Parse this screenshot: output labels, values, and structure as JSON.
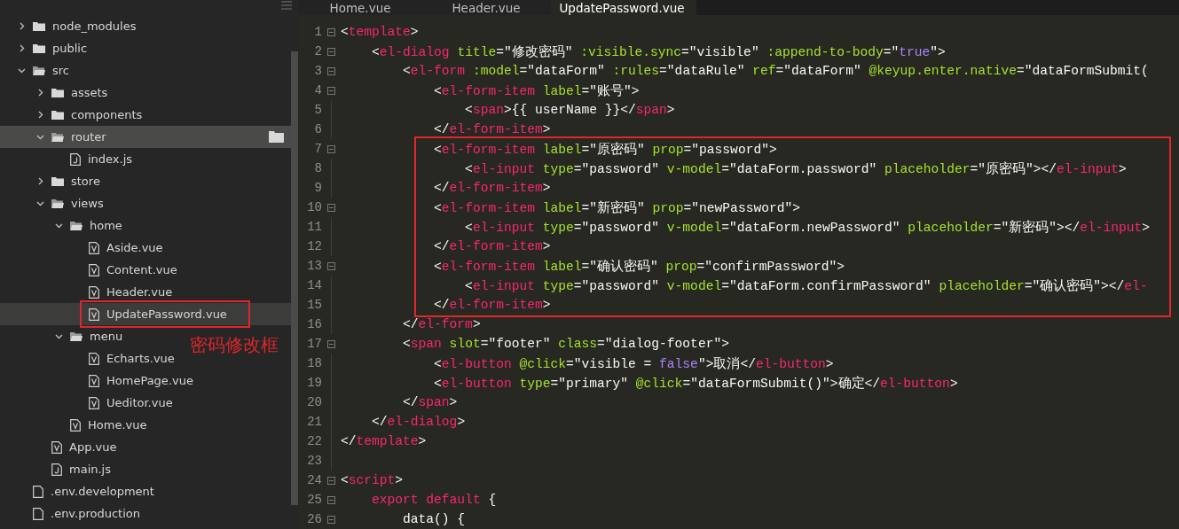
{
  "sidebar": {
    "annotation": {
      "text": "密码修改框"
    },
    "tree": [
      {
        "label": "node_modules",
        "kind": "folder",
        "expanded": false,
        "selected": false,
        "hovered": false,
        "annotated": false
      },
      {
        "label": "public",
        "kind": "folder",
        "expanded": false,
        "selected": false,
        "hovered": false,
        "annotated": false
      },
      {
        "label": "src",
        "kind": "folder",
        "expanded": true,
        "selected": false,
        "hovered": false,
        "annotated": false,
        "children": [
          {
            "label": "assets",
            "kind": "folder",
            "expanded": false,
            "selected": false,
            "hovered": false,
            "annotated": false
          },
          {
            "label": "components",
            "kind": "folder",
            "expanded": false,
            "selected": false,
            "hovered": false,
            "annotated": false
          },
          {
            "label": "router",
            "kind": "folder",
            "expanded": true,
            "selected": false,
            "hovered": true,
            "annotated": false,
            "children": [
              {
                "label": "index.js",
                "kind": "js-file",
                "selected": false,
                "hovered": false,
                "annotated": false
              }
            ]
          },
          {
            "label": "store",
            "kind": "folder",
            "expanded": false,
            "selected": false,
            "hovered": false,
            "annotated": false
          },
          {
            "label": "views",
            "kind": "folder",
            "expanded": true,
            "selected": false,
            "hovered": false,
            "annotated": false,
            "children": [
              {
                "label": "home",
                "kind": "folder",
                "expanded": true,
                "selected": false,
                "hovered": false,
                "annotated": false,
                "children": [
                  {
                    "label": "Aside.vue",
                    "kind": "vue-file",
                    "selected": false,
                    "hovered": false,
                    "annotated": false
                  },
                  {
                    "label": "Content.vue",
                    "kind": "vue-file",
                    "selected": false,
                    "hovered": false,
                    "annotated": false
                  },
                  {
                    "label": "Header.vue",
                    "kind": "vue-file",
                    "selected": false,
                    "hovered": false,
                    "annotated": false
                  },
                  {
                    "label": "UpdatePassword.vue",
                    "kind": "vue-file",
                    "selected": true,
                    "hovered": false,
                    "annotated": true
                  }
                ]
              },
              {
                "label": "menu",
                "kind": "folder",
                "expanded": true,
                "selected": false,
                "hovered": false,
                "annotated": false,
                "children": [
                  {
                    "label": "Echarts.vue",
                    "kind": "vue-file",
                    "selected": false,
                    "hovered": false,
                    "annotated": false
                  },
                  {
                    "label": "HomePage.vue",
                    "kind": "vue-file",
                    "selected": false,
                    "hovered": false,
                    "annotated": false
                  },
                  {
                    "label": "Ueditor.vue",
                    "kind": "vue-file",
                    "selected": false,
                    "hovered": false,
                    "annotated": false
                  }
                ]
              },
              {
                "label": "Home.vue",
                "kind": "vue-file",
                "selected": false,
                "hovered": false,
                "annotated": false
              }
            ]
          },
          {
            "label": "App.vue",
            "kind": "vue-file",
            "selected": false,
            "hovered": false,
            "annotated": false
          },
          {
            "label": "main.js",
            "kind": "js-file",
            "selected": false,
            "hovered": false,
            "annotated": false
          }
        ]
      },
      {
        "label": ".env.development",
        "kind": "file",
        "selected": false,
        "hovered": false,
        "annotated": false
      },
      {
        "label": ".env.production",
        "kind": "file",
        "selected": false,
        "hovered": false,
        "annotated": false
      }
    ]
  },
  "tabs": [
    {
      "label": "Home.vue",
      "selected": false
    },
    {
      "label": "Header.vue",
      "selected": false
    },
    {
      "label": "UpdatePassword.vue",
      "selected": true
    }
  ],
  "code": [
    {
      "number": "1",
      "fold": true,
      "highlight": false,
      "tokens": [
        {
          "kind": "p",
          "text": "<"
        },
        {
          "kind": "t",
          "text": "template"
        },
        {
          "kind": "p",
          "text": ">"
        }
      ]
    },
    {
      "number": "2",
      "fold": true,
      "highlight": false,
      "tokens": [
        {
          "kind": "p",
          "text": "    <"
        },
        {
          "kind": "t",
          "text": "el-dialog"
        },
        {
          "kind": "a",
          "text": " title"
        },
        {
          "kind": "p",
          "text": "=\"修改密码\""
        },
        {
          "kind": "a",
          "text": " :visible.sync"
        },
        {
          "kind": "p",
          "text": "=\"visible\""
        },
        {
          "kind": "a",
          "text": " :append-to-body"
        },
        {
          "kind": "p",
          "text": "=\""
        },
        {
          "kind": "c",
          "text": "true"
        },
        {
          "kind": "p",
          "text": "\">"
        }
      ]
    },
    {
      "number": "3",
      "fold": true,
      "highlight": false,
      "tokens": [
        {
          "kind": "p",
          "text": "        <"
        },
        {
          "kind": "t",
          "text": "el-form"
        },
        {
          "kind": "a",
          "text": " :model"
        },
        {
          "kind": "p",
          "text": "=\"dataForm\""
        },
        {
          "kind": "a",
          "text": " :rules"
        },
        {
          "kind": "p",
          "text": "=\"dataRule\""
        },
        {
          "kind": "a",
          "text": " ref"
        },
        {
          "kind": "p",
          "text": "=\"dataForm\""
        },
        {
          "kind": "a",
          "text": " @keyup.enter.native"
        },
        {
          "kind": "p",
          "text": "=\"dataFormSubmit("
        }
      ]
    },
    {
      "number": "4",
      "fold": true,
      "highlight": false,
      "tokens": [
        {
          "kind": "p",
          "text": "            <"
        },
        {
          "kind": "t",
          "text": "el-form-item"
        },
        {
          "kind": "a",
          "text": " label"
        },
        {
          "kind": "p",
          "text": "=\"账号\">"
        }
      ]
    },
    {
      "number": "5",
      "fold": false,
      "highlight": false,
      "tokens": [
        {
          "kind": "p",
          "text": "                <"
        },
        {
          "kind": "t",
          "text": "span"
        },
        {
          "kind": "p",
          "text": ">{{ userName }}</"
        },
        {
          "kind": "t",
          "text": "span"
        },
        {
          "kind": "p",
          "text": ">"
        }
      ]
    },
    {
      "number": "6",
      "fold": false,
      "highlight": false,
      "tokens": [
        {
          "kind": "p",
          "text": "            </"
        },
        {
          "kind": "t",
          "text": "el-form-item"
        },
        {
          "kind": "p",
          "text": ">"
        }
      ]
    },
    {
      "number": "7",
      "fold": true,
      "highlight": true,
      "tokens": [
        {
          "kind": "p",
          "text": "            <"
        },
        {
          "kind": "t",
          "text": "el-form-item"
        },
        {
          "kind": "a",
          "text": " label"
        },
        {
          "kind": "p",
          "text": "=\"原密码\""
        },
        {
          "kind": "a",
          "text": " prop"
        },
        {
          "kind": "p",
          "text": "=\"password\">"
        }
      ]
    },
    {
      "number": "8",
      "fold": false,
      "highlight": true,
      "tokens": [
        {
          "kind": "p",
          "text": "                <"
        },
        {
          "kind": "t",
          "text": "el-input"
        },
        {
          "kind": "a",
          "text": " type"
        },
        {
          "kind": "p",
          "text": "=\"password\""
        },
        {
          "kind": "a",
          "text": " v-model"
        },
        {
          "kind": "p",
          "text": "=\"dataForm.password\""
        },
        {
          "kind": "a",
          "text": " placeholder"
        },
        {
          "kind": "p",
          "text": "=\"原密码\"></"
        },
        {
          "kind": "t",
          "text": "el-input"
        },
        {
          "kind": "p",
          "text": ">"
        }
      ]
    },
    {
      "number": "9",
      "fold": false,
      "highlight": true,
      "tokens": [
        {
          "kind": "p",
          "text": "            </"
        },
        {
          "kind": "t",
          "text": "el-form-item"
        },
        {
          "kind": "p",
          "text": ">"
        }
      ]
    },
    {
      "number": "10",
      "fold": true,
      "highlight": true,
      "tokens": [
        {
          "kind": "p",
          "text": "            <"
        },
        {
          "kind": "t",
          "text": "el-form-item"
        },
        {
          "kind": "a",
          "text": " label"
        },
        {
          "kind": "p",
          "text": "=\"新密码\""
        },
        {
          "kind": "a",
          "text": " prop"
        },
        {
          "kind": "p",
          "text": "=\"newPassword\">"
        }
      ]
    },
    {
      "number": "11",
      "fold": false,
      "highlight": true,
      "tokens": [
        {
          "kind": "p",
          "text": "                <"
        },
        {
          "kind": "t",
          "text": "el-input"
        },
        {
          "kind": "a",
          "text": " type"
        },
        {
          "kind": "p",
          "text": "=\"password\""
        },
        {
          "kind": "a",
          "text": " v-model"
        },
        {
          "kind": "p",
          "text": "=\"dataForm.newPassword\""
        },
        {
          "kind": "a",
          "text": " placeholder"
        },
        {
          "kind": "p",
          "text": "=\"新密码\"></"
        },
        {
          "kind": "t",
          "text": "el-input"
        },
        {
          "kind": "p",
          "text": ">"
        }
      ]
    },
    {
      "number": "12",
      "fold": false,
      "highlight": true,
      "tokens": [
        {
          "kind": "p",
          "text": "            </"
        },
        {
          "kind": "t",
          "text": "el-form-item"
        },
        {
          "kind": "p",
          "text": ">"
        }
      ]
    },
    {
      "number": "13",
      "fold": true,
      "highlight": true,
      "tokens": [
        {
          "kind": "p",
          "text": "            <"
        },
        {
          "kind": "t",
          "text": "el-form-item"
        },
        {
          "kind": "a",
          "text": " label"
        },
        {
          "kind": "p",
          "text": "=\"确认密码\""
        },
        {
          "kind": "a",
          "text": " prop"
        },
        {
          "kind": "p",
          "text": "=\"confirmPassword\">"
        }
      ]
    },
    {
      "number": "14",
      "fold": false,
      "highlight": true,
      "tokens": [
        {
          "kind": "p",
          "text": "                <"
        },
        {
          "kind": "t",
          "text": "el-input"
        },
        {
          "kind": "a",
          "text": " type"
        },
        {
          "kind": "p",
          "text": "=\"password\""
        },
        {
          "kind": "a",
          "text": " v-model"
        },
        {
          "kind": "p",
          "text": "=\"dataForm.confirmPassword\""
        },
        {
          "kind": "a",
          "text": " placeholder"
        },
        {
          "kind": "p",
          "text": "=\"确认密码\"></"
        },
        {
          "kind": "t",
          "text": "el-"
        }
      ]
    },
    {
      "number": "15",
      "fold": false,
      "highlight": true,
      "tokens": [
        {
          "kind": "p",
          "text": "            </"
        },
        {
          "kind": "t",
          "text": "el-form-item"
        },
        {
          "kind": "p",
          "text": ">"
        }
      ]
    },
    {
      "number": "16",
      "fold": false,
      "highlight": false,
      "tokens": [
        {
          "kind": "p",
          "text": "        </"
        },
        {
          "kind": "t",
          "text": "el-form"
        },
        {
          "kind": "p",
          "text": ">"
        }
      ]
    },
    {
      "number": "17",
      "fold": true,
      "highlight": false,
      "tokens": [
        {
          "kind": "p",
          "text": "        <"
        },
        {
          "kind": "t",
          "text": "span"
        },
        {
          "kind": "a",
          "text": " slot"
        },
        {
          "kind": "p",
          "text": "=\"footer\""
        },
        {
          "kind": "a",
          "text": " class"
        },
        {
          "kind": "p",
          "text": "=\"dialog-footer\">"
        }
      ]
    },
    {
      "number": "18",
      "fold": false,
      "highlight": false,
      "tokens": [
        {
          "kind": "p",
          "text": "            <"
        },
        {
          "kind": "t",
          "text": "el-button"
        },
        {
          "kind": "a",
          "text": " @click"
        },
        {
          "kind": "p",
          "text": "=\"visible = "
        },
        {
          "kind": "c",
          "text": "false"
        },
        {
          "kind": "p",
          "text": "\">取消</"
        },
        {
          "kind": "t",
          "text": "el-button"
        },
        {
          "kind": "p",
          "text": ">"
        }
      ]
    },
    {
      "number": "19",
      "fold": false,
      "highlight": false,
      "tokens": [
        {
          "kind": "p",
          "text": "            <"
        },
        {
          "kind": "t",
          "text": "el-button"
        },
        {
          "kind": "a",
          "text": " type"
        },
        {
          "kind": "p",
          "text": "=\"primary\""
        },
        {
          "kind": "a",
          "text": " @click"
        },
        {
          "kind": "p",
          "text": "=\"dataFormSubmit()\">确定</"
        },
        {
          "kind": "t",
          "text": "el-button"
        },
        {
          "kind": "p",
          "text": ">"
        }
      ]
    },
    {
      "number": "20",
      "fold": false,
      "highlight": false,
      "tokens": [
        {
          "kind": "p",
          "text": "        </"
        },
        {
          "kind": "t",
          "text": "span"
        },
        {
          "kind": "p",
          "text": ">"
        }
      ]
    },
    {
      "number": "21",
      "fold": false,
      "highlight": false,
      "tokens": [
        {
          "kind": "p",
          "text": "    </"
        },
        {
          "kind": "t",
          "text": "el-dialog"
        },
        {
          "kind": "p",
          "text": ">"
        }
      ]
    },
    {
      "number": "22",
      "fold": false,
      "highlight": false,
      "tokens": [
        {
          "kind": "p",
          "text": "</"
        },
        {
          "kind": "t",
          "text": "template"
        },
        {
          "kind": "p",
          "text": ">"
        }
      ]
    },
    {
      "number": "23",
      "fold": false,
      "highlight": false
    },
    {
      "number": "24",
      "fold": true,
      "highlight": false,
      "tokens": [
        {
          "kind": "p",
          "text": "<"
        },
        {
          "kind": "t",
          "text": "script"
        },
        {
          "kind": "p",
          "text": ">"
        }
      ]
    },
    {
      "number": "25",
      "fold": true,
      "highlight": false,
      "tokens": [
        {
          "kind": "t",
          "text": "    export default"
        },
        {
          "kind": "p",
          "text": " {"
        }
      ]
    },
    {
      "number": "26",
      "fold": true,
      "highlight": false,
      "tokens": [
        {
          "kind": "p",
          "text": "        data() {"
        }
      ]
    }
  ]
}
